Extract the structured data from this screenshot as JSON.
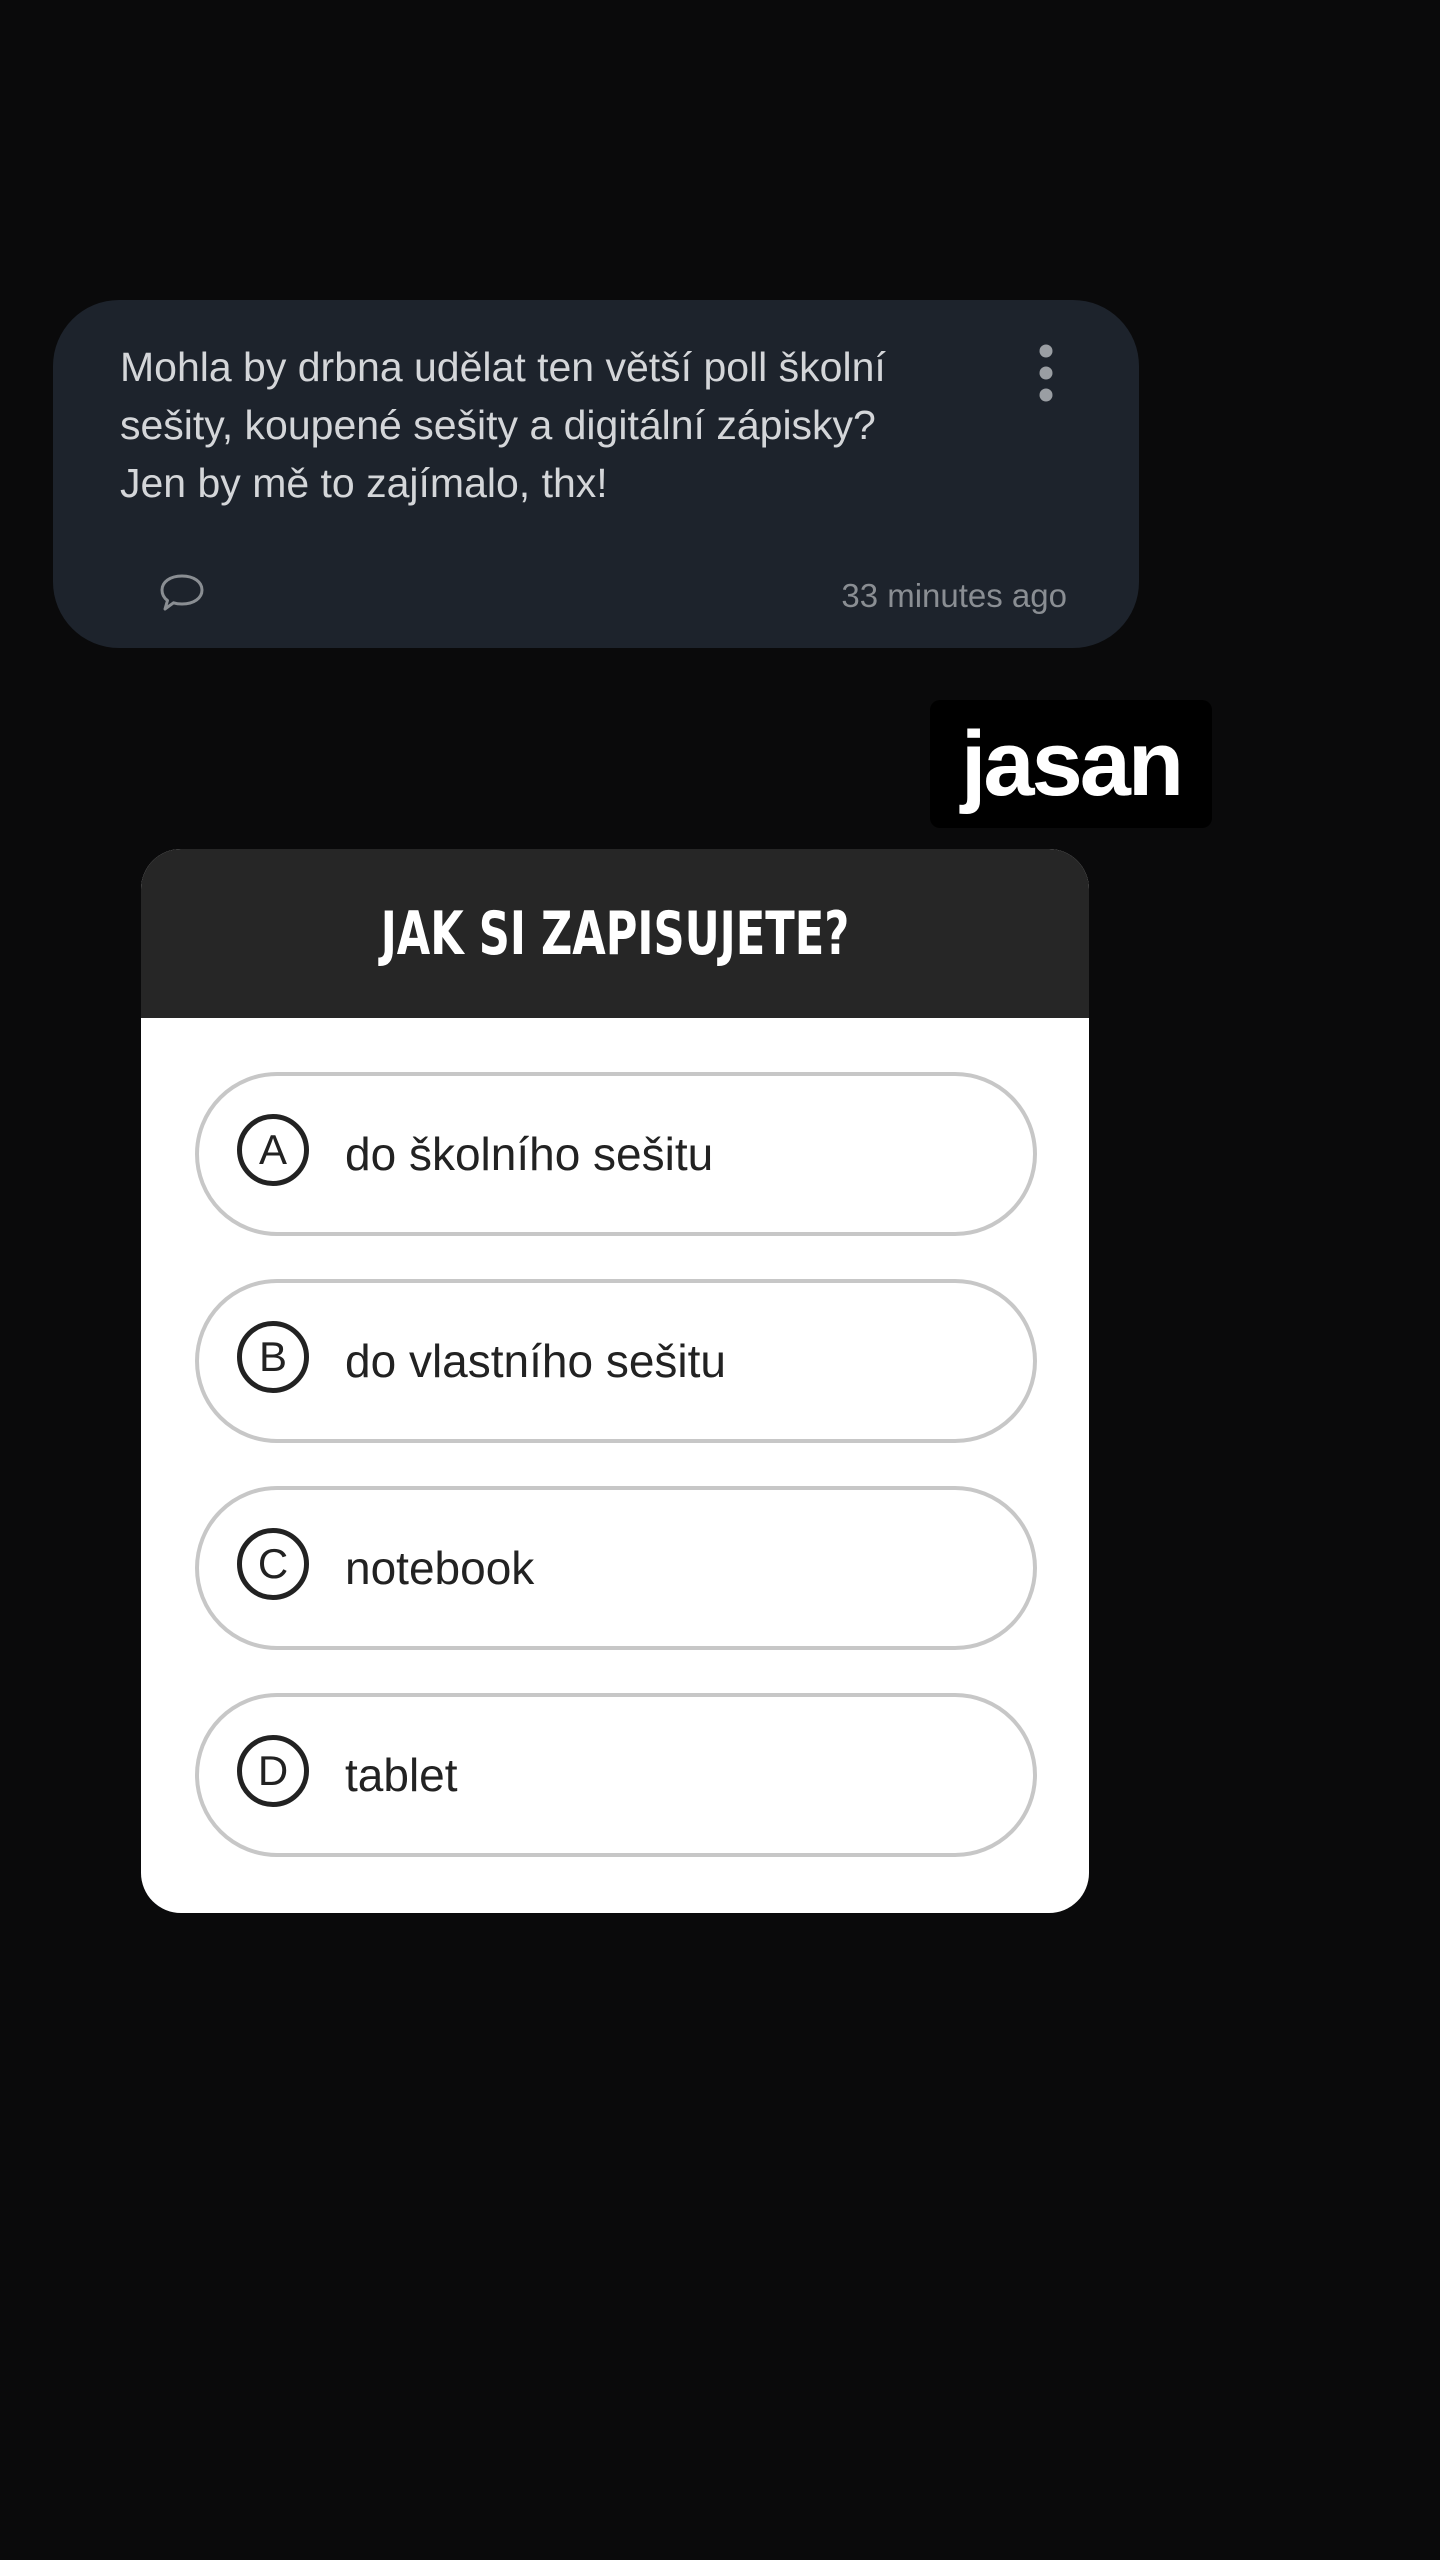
{
  "question": {
    "text_lines": [
      "Mohla by drbna udělat ten větší poll školní",
      "sešity, koupené sešity a digitální zápisky?",
      "Jen by mě to zajímalo, thx!"
    ],
    "timestamp": "33 minutes ago",
    "icons": {
      "more": "more-vertical-icon",
      "comment": "comment-bubble-icon"
    }
  },
  "reply": {
    "text": "jasan"
  },
  "poll": {
    "title": "JAK SI ZAPISUJETE?",
    "options": [
      {
        "letter": "A",
        "label": "do školního sešitu"
      },
      {
        "letter": "B",
        "label": "do vlastního sešitu"
      },
      {
        "letter": "C",
        "label": "notebook"
      },
      {
        "letter": "D",
        "label": "tablet"
      }
    ]
  },
  "colors": {
    "background": "#0a0a0b",
    "bubble": "#1d232c",
    "poll_header": "#262626",
    "poll_body": "#ffffff",
    "option_border": "#c7c7c7"
  }
}
